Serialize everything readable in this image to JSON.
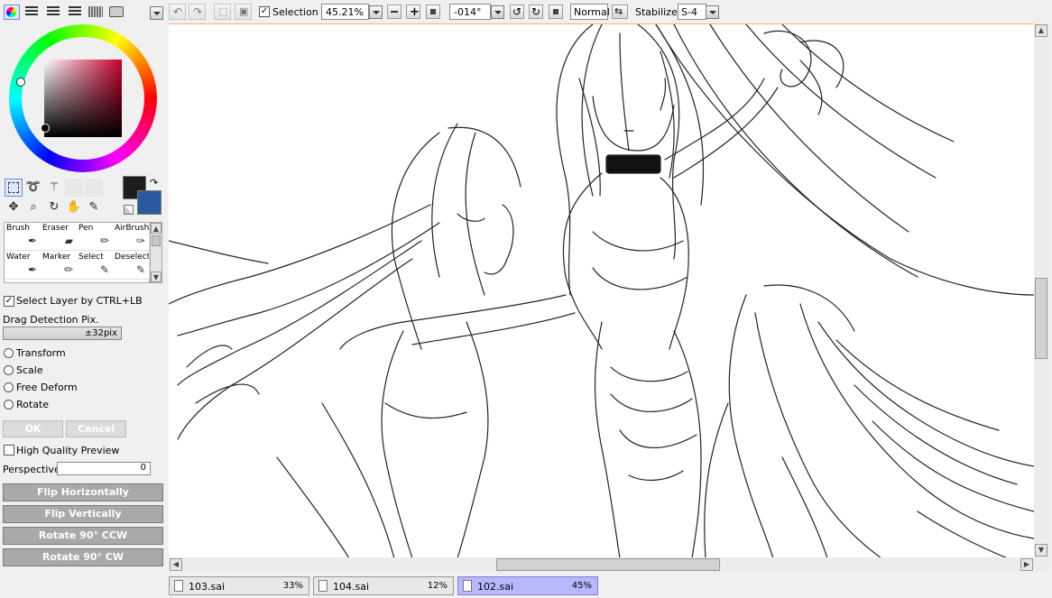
{
  "toolbar": {
    "selection_label": "Selection",
    "selection_checked": true,
    "zoom_value": "45.21%",
    "angle_value": "-014°",
    "blend_mode": "Normal",
    "stabilizer_label": "Stabilizer",
    "stabilizer_value": "S-4"
  },
  "colors": {
    "primary": "#1e1e1e",
    "secondary": "#2c5aa0",
    "accent_border": "#ffb070",
    "tab_active": "#b8b8ff"
  },
  "brushes": [
    {
      "label": "Brush",
      "icon": "brush-icon"
    },
    {
      "label": "Eraser",
      "icon": "eraser-icon"
    },
    {
      "label": "Pen",
      "icon": "pen-icon"
    },
    {
      "label": "AirBrush",
      "icon": "airbrush-icon"
    },
    {
      "label": "Water",
      "icon": "water-icon"
    },
    {
      "label": "Marker",
      "icon": "marker-icon"
    },
    {
      "label": "Select",
      "icon": "select-brush-icon"
    },
    {
      "label": "Deselect",
      "icon": "deselect-icon"
    }
  ],
  "transform_panel": {
    "select_layer_label": "Select Layer by CTRL+LB",
    "drag_detection_label": "Drag Detection Pix.",
    "drag_detection_value": "±32pix",
    "options": [
      "Transform",
      "Scale",
      "Free Deform",
      "Rotate"
    ],
    "ok_label": "OK",
    "cancel_label": "Cancel",
    "hq_preview_label": "High Quality Preview",
    "perspective_label": "Perspective",
    "perspective_value": "0",
    "flip_h_label": "Flip Horizontally",
    "flip_v_label": "Flip Vertically",
    "rot_ccw_label": "Rotate 90° CCW",
    "rot_cw_label": "Rotate 90° CW"
  },
  "tabs": [
    {
      "name": "103.sai",
      "zoom": "33%"
    },
    {
      "name": "104.sai",
      "zoom": "12%"
    },
    {
      "name": "102.sai",
      "zoom": "45%"
    }
  ]
}
